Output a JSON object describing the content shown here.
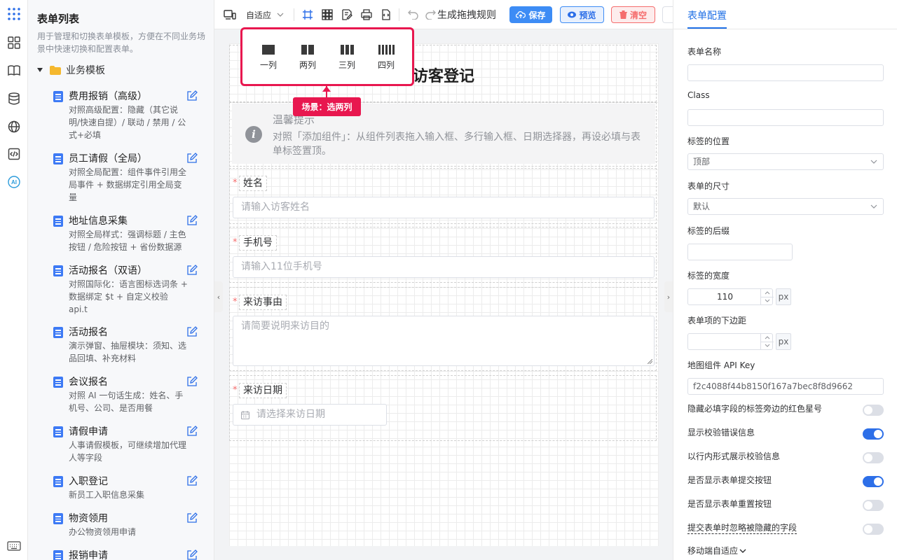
{
  "left_panel": {
    "title": "表单列表",
    "description": "用于管理和切换表单模板，方便在不同业务场景中快速切换和配置表单。",
    "folder": "业务模板",
    "templates": [
      {
        "name": "费用报销（高级）",
        "desc": "对照高级配置：隐藏（其它说明/快速自提）/ 联动 / 禁用 / 公式+必填"
      },
      {
        "name": "员工请假（全局）",
        "desc": "对照全局配置：组件事件引用全局事件 + 数据绑定引用全局变量"
      },
      {
        "name": "地址信息采集",
        "desc": "对照全局样式：强调标题 / 主色按钮 / 危险按钮 + 省份数据源"
      },
      {
        "name": "活动报名（双语）",
        "desc": "对照国际化：语言图标选词条 + 数据绑定 $t + 自定义校验 api.t"
      },
      {
        "name": "活动报名",
        "desc": "演示弹窗、抽屉模块：须知、选品回填、补充材料"
      },
      {
        "name": "会议报名",
        "desc": "对照 AI 一句话生成：姓名、手机号、公司、是否用餐"
      },
      {
        "name": "请假申请",
        "desc": "人事请假模板，可继续增加代理人等字段"
      },
      {
        "name": "入职登记",
        "desc": "新员工入职信息采集"
      },
      {
        "name": "物资领用",
        "desc": "办公物资领用申请"
      },
      {
        "name": "报销申请",
        "desc": ""
      }
    ]
  },
  "toolbar": {
    "adapt_label": "自适应",
    "generate_label": "生成拖拽规则",
    "save_label": "保存",
    "preview_label": "预览",
    "clear_label": "清空"
  },
  "column_popover": {
    "options": [
      "一列",
      "两列",
      "三列",
      "四列"
    ],
    "tooltip": "场景：选两列"
  },
  "canvas": {
    "title": "访客登记",
    "notice_title": "温馨提示",
    "notice_text": "对照「添加组件」：从组件列表拖入输入框、多行输入框、日期选择器，再设必填与表单标签置顶。",
    "fields": [
      {
        "label": "姓名",
        "placeholder": "请输入访客姓名"
      },
      {
        "label": "手机号",
        "placeholder": "请输入11位手机号"
      },
      {
        "label": "来访事由",
        "placeholder": "请简要说明来访目的"
      },
      {
        "label": "来访日期",
        "placeholder": "请选择来访日期"
      }
    ]
  },
  "right_panel": {
    "tab": "表单配置",
    "form_name_label": "表单名称",
    "form_name_value": "",
    "class_label": "Class",
    "class_value": "",
    "label_position_label": "标签的位置",
    "label_position_value": "顶部",
    "form_size_label": "表单的尺寸",
    "form_size_value": "默认",
    "label_suffix_label": "标签的后缀",
    "label_width_label": "标签的宽度",
    "label_width_value": "110",
    "unit": "px",
    "item_margin_label": "表单项的下边距",
    "map_key_label": "地图组件 API Key",
    "map_key_value": "f2c4088f44b8150f167a7bec8f8d9662",
    "toggles": [
      {
        "label": "隐藏必填字段的标签旁边的红色星号",
        "on": false
      },
      {
        "label": "显示校验错误信息",
        "on": true
      },
      {
        "label": "以行内形式展示校验信息",
        "on": false
      },
      {
        "label": "是否显示表单提交按钮",
        "on": true
      },
      {
        "label": "是否显示表单重置按钮",
        "on": false
      },
      {
        "label": "提交表单时忽略被隐藏的字段",
        "on": false
      }
    ],
    "mobile_label": "移动端自适应"
  },
  "colors": {
    "accent": "#2d6fe8",
    "highlight": "#e8174f",
    "danger": "#f56c6c"
  }
}
